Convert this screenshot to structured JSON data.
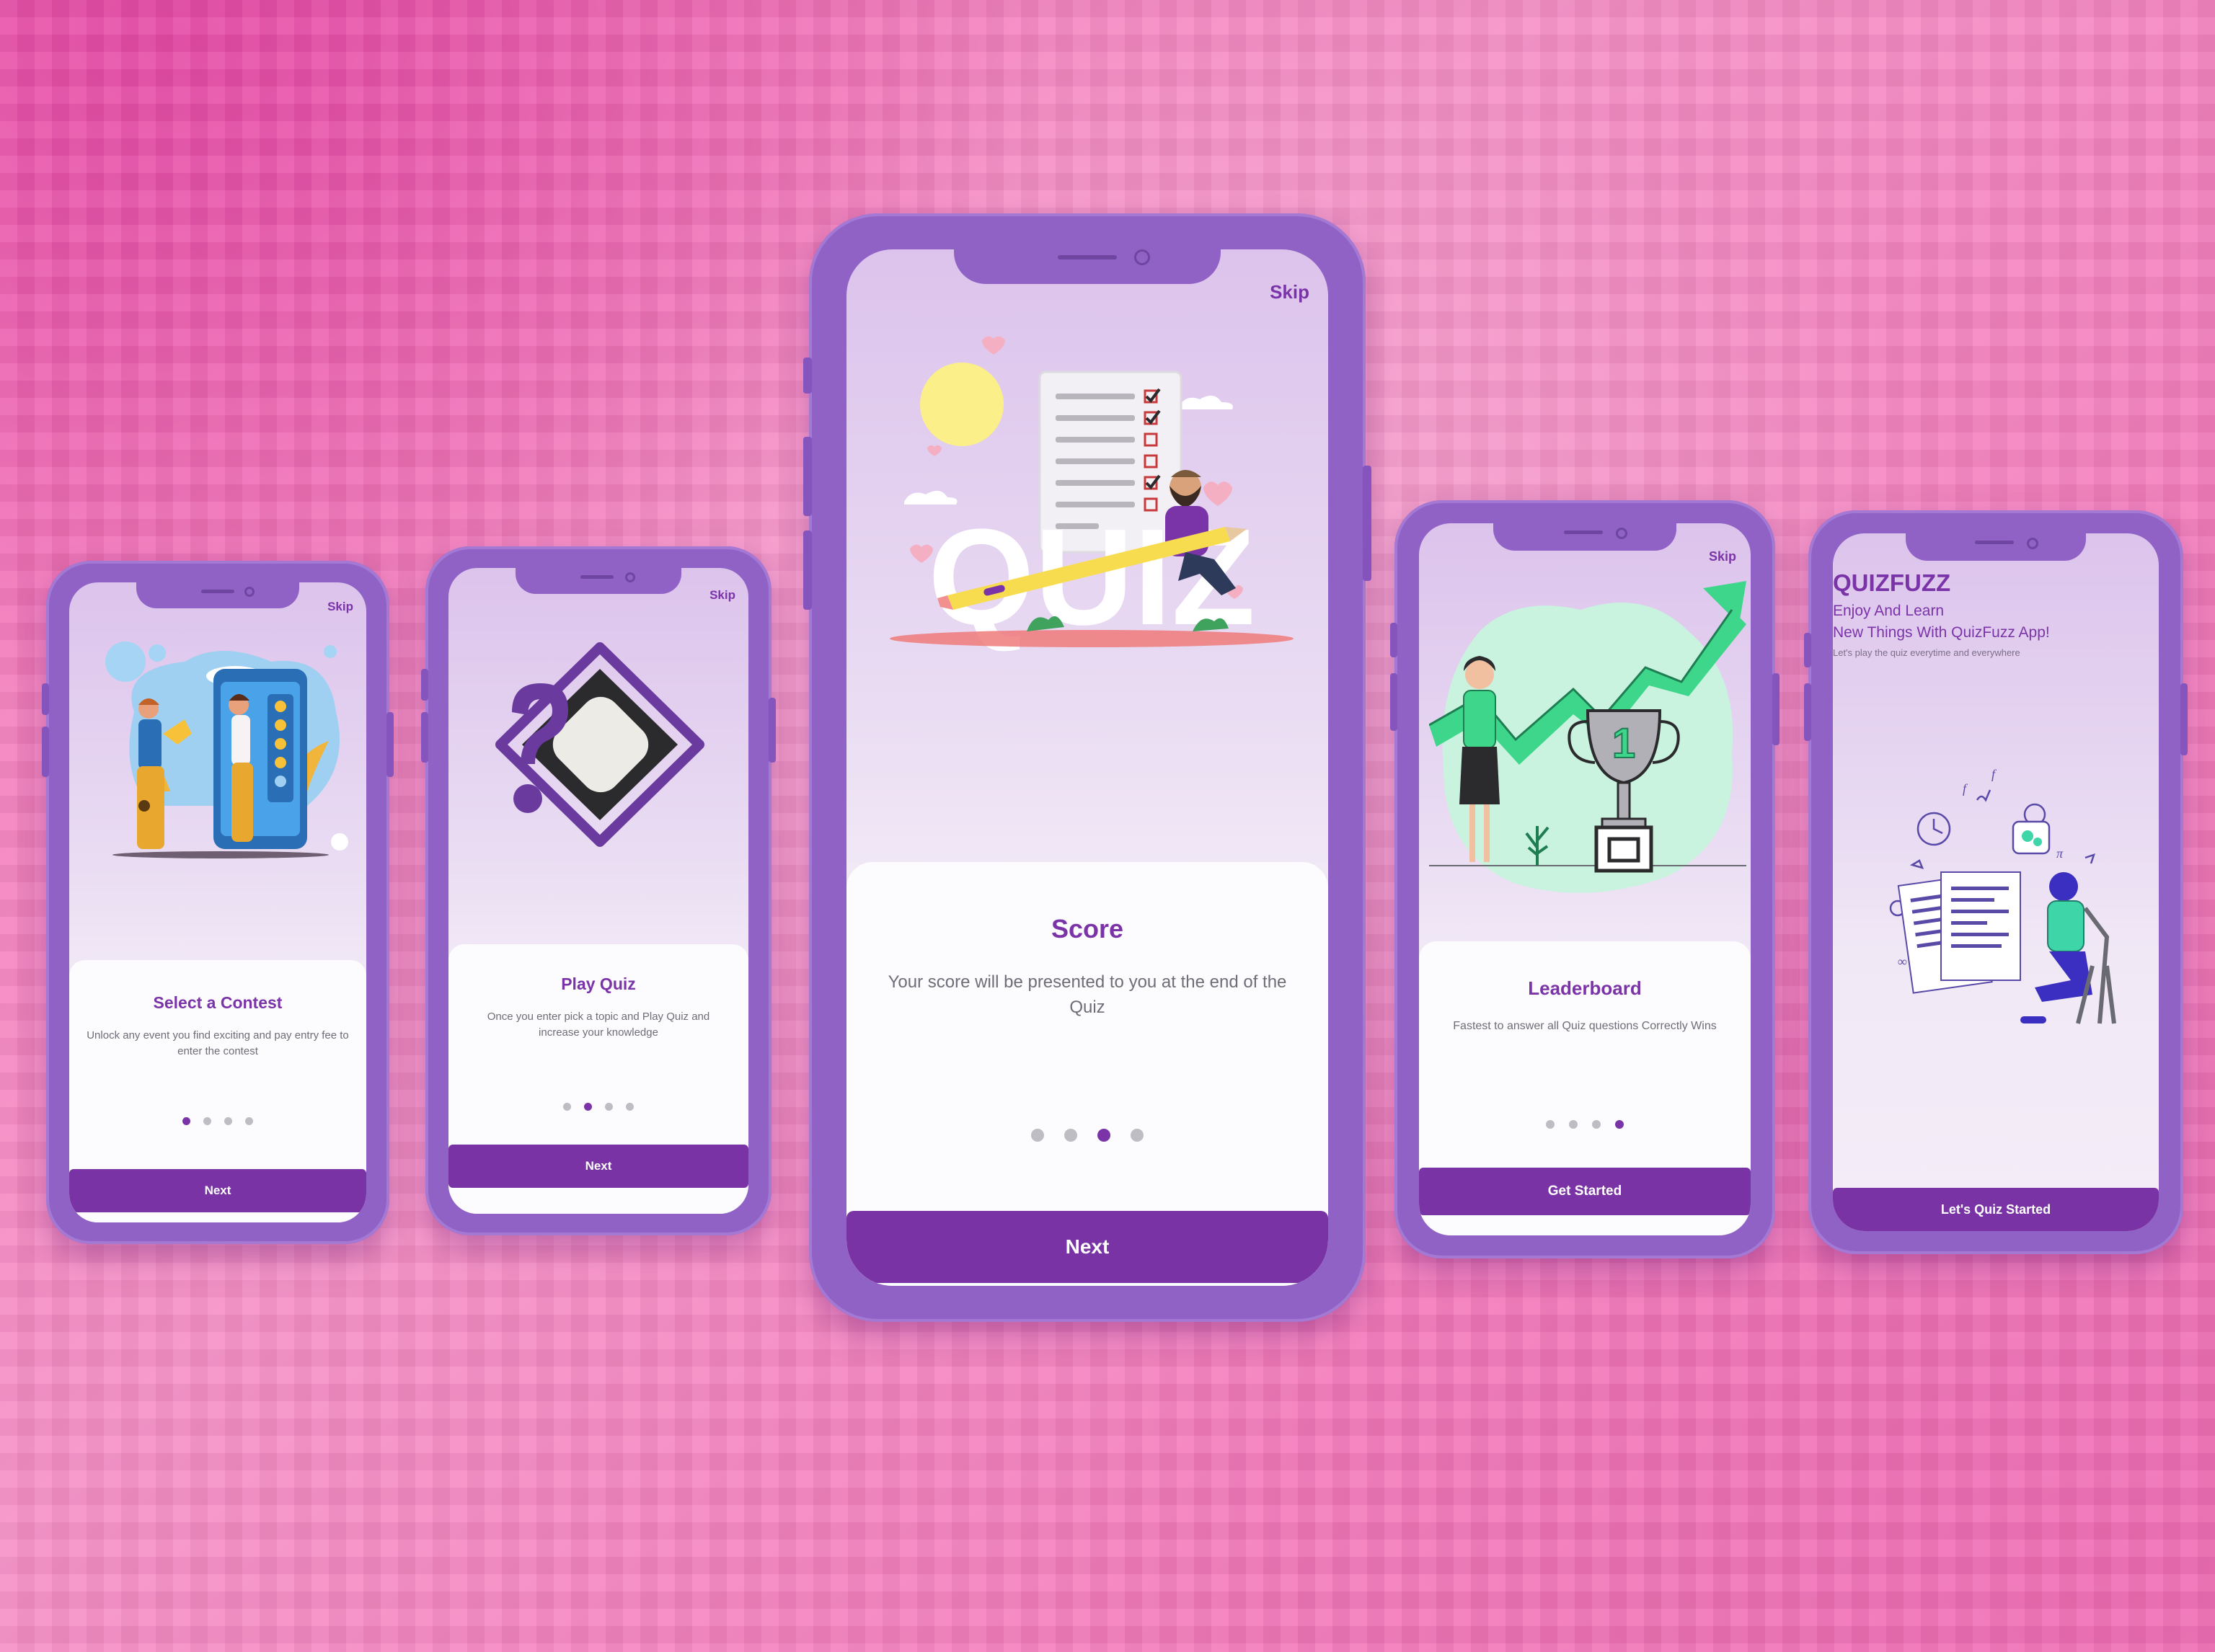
{
  "screens": [
    {
      "skip": "Skip",
      "title": "Select a Contest",
      "description": "Unlock any event you find exciting and pay entry fee to enter the contest",
      "dots": {
        "total": 4,
        "active": 1
      },
      "button": "Next",
      "illustration": "people-rating-phone-illustration"
    },
    {
      "skip": "Skip",
      "title": "Play Quiz",
      "description": "Once you enter pick a topic and Play Quiz and increase your knowledge",
      "dots": {
        "total": 4,
        "active": 2
      },
      "button": "Next",
      "illustration": "question-mark-frame-illustration"
    },
    {
      "skip": "Skip",
      "title": "Score",
      "description": "Your score will be presented to you at the end of the Quiz",
      "dots": {
        "total": 4,
        "active": 3
      },
      "button": "Next",
      "illustration": "quiz-checklist-pencil-illustration",
      "illustration_word": "QUIZ"
    },
    {
      "skip": "Skip",
      "title": "Leaderboard",
      "description": "Fastest to answer all Quiz questions Correctly Wins",
      "dots": {
        "total": 4,
        "active": 4
      },
      "button": "Get Started",
      "illustration": "trophy-growth-chart-illustration",
      "trophy_number": "1"
    },
    {
      "brand": "QUIZFUZZ",
      "tagline_1": "Enjoy And Learn",
      "tagline_2": "New Things With QuizFuzz App!",
      "tagline_3": "Let's play the quiz everytime and everywhere",
      "button": "Let's Quiz Started",
      "illustration": "student-studying-math-illustration"
    }
  ],
  "colors": {
    "brand_purple": "#7a33a5",
    "phone_frame": "#9062c6",
    "dot_inactive": "#bdbdc3",
    "background_pink": "#f690c6"
  }
}
